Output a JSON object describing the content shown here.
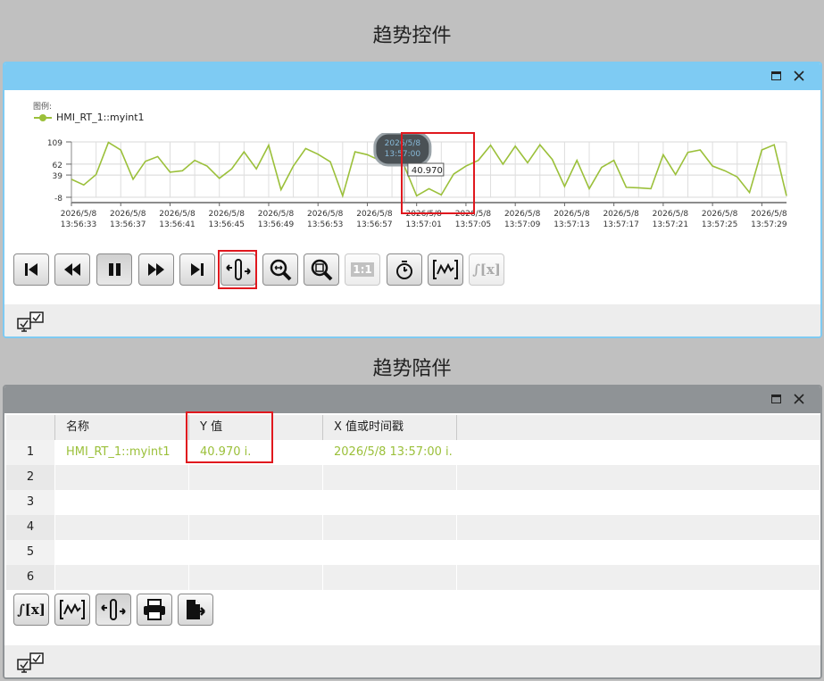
{
  "trend_control": {
    "heading": "趋势控件",
    "legend_title": "图例:",
    "legend_series": "HMI_RT_1::myint1",
    "y_ticks": [
      "109",
      "62",
      "39",
      "-8"
    ],
    "x_ticks": [
      [
        "2026/5/8",
        "13:56:33"
      ],
      [
        "2026/5/8",
        "13:56:37"
      ],
      [
        "2026/5/8",
        "13:56:41"
      ],
      [
        "2026/5/8",
        "13:56:45"
      ],
      [
        "2026/5/8",
        "13:56:49"
      ],
      [
        "2026/5/8",
        "13:56:53"
      ],
      [
        "2026/5/8",
        "13:56:57"
      ],
      [
        "2026/5/8",
        "13:57:01"
      ],
      [
        "2026/5/8",
        "13:57:05"
      ],
      [
        "2026/5/8",
        "13:57:09"
      ],
      [
        "2026/5/8",
        "13:57:13"
      ],
      [
        "2026/5/8",
        "13:57:17"
      ],
      [
        "2026/5/8",
        "13:57:21"
      ],
      [
        "2026/5/8",
        "13:57:25"
      ],
      [
        "2026/5/8",
        "13:57:29"
      ]
    ],
    "ruler_time_date": "2026/5/8",
    "ruler_time_clock": "13:57:00",
    "ruler_value": "40.970",
    "accent_color": "#9bc03a",
    "titlebar_color": "#7ecbf3"
  },
  "chart_data": {
    "type": "line",
    "series_name": "HMI_RT_1::myint1",
    "ylim": [
      -8,
      109
    ],
    "y_ticks": [
      109,
      62,
      39,
      -8
    ],
    "x_start": "13:56:33",
    "x_end": "13:57:31",
    "times_sec": [
      0,
      1,
      2,
      3,
      4,
      5,
      6,
      7,
      8,
      9,
      10,
      11,
      12,
      13,
      14,
      15,
      16,
      17,
      18,
      19,
      20,
      21,
      22,
      23,
      24,
      25,
      26,
      27,
      28,
      29,
      30,
      31,
      32,
      33,
      34,
      35,
      36,
      37,
      38,
      39,
      40,
      41,
      42,
      43,
      44,
      45,
      46,
      47,
      48,
      49,
      50,
      51,
      52,
      53,
      54,
      55,
      56,
      57,
      58
    ],
    "values": [
      30,
      18,
      40,
      108,
      92,
      30,
      68,
      78,
      45,
      48,
      70,
      58,
      32,
      52,
      88,
      52,
      102,
      8,
      58,
      95,
      83,
      67,
      -5,
      88,
      82,
      70,
      103,
      58,
      -5,
      10,
      -3,
      40.97,
      58,
      70,
      102,
      62,
      100,
      65,
      103,
      72,
      15,
      70,
      10,
      55,
      70,
      13,
      12,
      10,
      82,
      40,
      87,
      92,
      58,
      48,
      35,
      2,
      92,
      103,
      -5,
      5,
      30
    ],
    "grid": true,
    "legend_position": "top-left"
  },
  "toolbar1": {
    "buttons": [
      {
        "name": "first-page-button",
        "icon": "skip-back-icon",
        "disabled": false
      },
      {
        "name": "rewind-button",
        "icon": "rewind-icon",
        "disabled": false
      },
      {
        "name": "pause-button",
        "icon": "pause-icon",
        "disabled": false
      },
      {
        "name": "forward-button",
        "icon": "fast-forward-icon",
        "disabled": false
      },
      {
        "name": "last-page-button",
        "icon": "skip-forward-icon",
        "disabled": false
      },
      {
        "name": "ruler-button",
        "icon": "ruler-icon",
        "disabled": false
      },
      {
        "name": "zoom-in-button",
        "icon": "zoom-area-icon",
        "disabled": false
      },
      {
        "name": "zoom-out-button",
        "icon": "zoom-reset-icon",
        "disabled": false
      },
      {
        "name": "original-size-button",
        "icon": "one-to-one-icon",
        "label": "1:1",
        "disabled": true
      },
      {
        "name": "stopwatch-button",
        "icon": "stopwatch-icon",
        "disabled": false
      },
      {
        "name": "trend-select-button",
        "icon": "trend-icon",
        "disabled": false
      },
      {
        "name": "statistics-button",
        "icon": "integral-icon",
        "label": "∫[x]",
        "disabled": true
      }
    ]
  },
  "companion": {
    "heading": "趋势陪伴",
    "columns": [
      "名称",
      "Y 值",
      "X 值或时间戳"
    ],
    "rows": [
      {
        "index": "1",
        "name": "HMI_RT_1::myint1",
        "y": "40.970 i.",
        "x": "2026/5/8 13:57:00 i."
      },
      {
        "index": "2",
        "name": "",
        "y": "",
        "x": ""
      },
      {
        "index": "3",
        "name": "",
        "y": "",
        "x": ""
      },
      {
        "index": "4",
        "name": "",
        "y": "",
        "x": ""
      },
      {
        "index": "5",
        "name": "",
        "y": "",
        "x": ""
      },
      {
        "index": "6",
        "name": "",
        "y": "",
        "x": ""
      }
    ],
    "toolbar_labels": {
      "statistics": "∫[x]"
    },
    "titlebar_color": "#8f9396"
  }
}
